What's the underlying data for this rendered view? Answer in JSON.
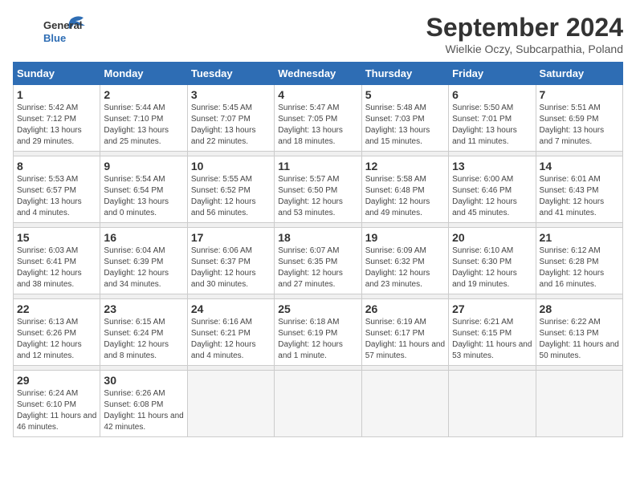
{
  "logo": {
    "general": "General",
    "blue": "Blue"
  },
  "title": "September 2024",
  "location": "Wielkie Oczy, Subcarpathia, Poland",
  "weekdays": [
    "Sunday",
    "Monday",
    "Tuesday",
    "Wednesday",
    "Thursday",
    "Friday",
    "Saturday"
  ],
  "weeks": [
    [
      {
        "day": 1,
        "sunrise": "5:42 AM",
        "sunset": "7:12 PM",
        "daylight": "13 hours and 29 minutes."
      },
      {
        "day": 2,
        "sunrise": "5:44 AM",
        "sunset": "7:10 PM",
        "daylight": "13 hours and 25 minutes."
      },
      {
        "day": 3,
        "sunrise": "5:45 AM",
        "sunset": "7:07 PM",
        "daylight": "13 hours and 22 minutes."
      },
      {
        "day": 4,
        "sunrise": "5:47 AM",
        "sunset": "7:05 PM",
        "daylight": "13 hours and 18 minutes."
      },
      {
        "day": 5,
        "sunrise": "5:48 AM",
        "sunset": "7:03 PM",
        "daylight": "13 hours and 15 minutes."
      },
      {
        "day": 6,
        "sunrise": "5:50 AM",
        "sunset": "7:01 PM",
        "daylight": "13 hours and 11 minutes."
      },
      {
        "day": 7,
        "sunrise": "5:51 AM",
        "sunset": "6:59 PM",
        "daylight": "13 hours and 7 minutes."
      }
    ],
    [
      {
        "day": 8,
        "sunrise": "5:53 AM",
        "sunset": "6:57 PM",
        "daylight": "13 hours and 4 minutes."
      },
      {
        "day": 9,
        "sunrise": "5:54 AM",
        "sunset": "6:54 PM",
        "daylight": "13 hours and 0 minutes."
      },
      {
        "day": 10,
        "sunrise": "5:55 AM",
        "sunset": "6:52 PM",
        "daylight": "12 hours and 56 minutes."
      },
      {
        "day": 11,
        "sunrise": "5:57 AM",
        "sunset": "6:50 PM",
        "daylight": "12 hours and 53 minutes."
      },
      {
        "day": 12,
        "sunrise": "5:58 AM",
        "sunset": "6:48 PM",
        "daylight": "12 hours and 49 minutes."
      },
      {
        "day": 13,
        "sunrise": "6:00 AM",
        "sunset": "6:46 PM",
        "daylight": "12 hours and 45 minutes."
      },
      {
        "day": 14,
        "sunrise": "6:01 AM",
        "sunset": "6:43 PM",
        "daylight": "12 hours and 41 minutes."
      }
    ],
    [
      {
        "day": 15,
        "sunrise": "6:03 AM",
        "sunset": "6:41 PM",
        "daylight": "12 hours and 38 minutes."
      },
      {
        "day": 16,
        "sunrise": "6:04 AM",
        "sunset": "6:39 PM",
        "daylight": "12 hours and 34 minutes."
      },
      {
        "day": 17,
        "sunrise": "6:06 AM",
        "sunset": "6:37 PM",
        "daylight": "12 hours and 30 minutes."
      },
      {
        "day": 18,
        "sunrise": "6:07 AM",
        "sunset": "6:35 PM",
        "daylight": "12 hours and 27 minutes."
      },
      {
        "day": 19,
        "sunrise": "6:09 AM",
        "sunset": "6:32 PM",
        "daylight": "12 hours and 23 minutes."
      },
      {
        "day": 20,
        "sunrise": "6:10 AM",
        "sunset": "6:30 PM",
        "daylight": "12 hours and 19 minutes."
      },
      {
        "day": 21,
        "sunrise": "6:12 AM",
        "sunset": "6:28 PM",
        "daylight": "12 hours and 16 minutes."
      }
    ],
    [
      {
        "day": 22,
        "sunrise": "6:13 AM",
        "sunset": "6:26 PM",
        "daylight": "12 hours and 12 minutes."
      },
      {
        "day": 23,
        "sunrise": "6:15 AM",
        "sunset": "6:24 PM",
        "daylight": "12 hours and 8 minutes."
      },
      {
        "day": 24,
        "sunrise": "6:16 AM",
        "sunset": "6:21 PM",
        "daylight": "12 hours and 4 minutes."
      },
      {
        "day": 25,
        "sunrise": "6:18 AM",
        "sunset": "6:19 PM",
        "daylight": "12 hours and 1 minute."
      },
      {
        "day": 26,
        "sunrise": "6:19 AM",
        "sunset": "6:17 PM",
        "daylight": "11 hours and 57 minutes."
      },
      {
        "day": 27,
        "sunrise": "6:21 AM",
        "sunset": "6:15 PM",
        "daylight": "11 hours and 53 minutes."
      },
      {
        "day": 28,
        "sunrise": "6:22 AM",
        "sunset": "6:13 PM",
        "daylight": "11 hours and 50 minutes."
      }
    ],
    [
      {
        "day": 29,
        "sunrise": "6:24 AM",
        "sunset": "6:10 PM",
        "daylight": "11 hours and 46 minutes."
      },
      {
        "day": 30,
        "sunrise": "6:26 AM",
        "sunset": "6:08 PM",
        "daylight": "11 hours and 42 minutes."
      },
      null,
      null,
      null,
      null,
      null
    ]
  ]
}
